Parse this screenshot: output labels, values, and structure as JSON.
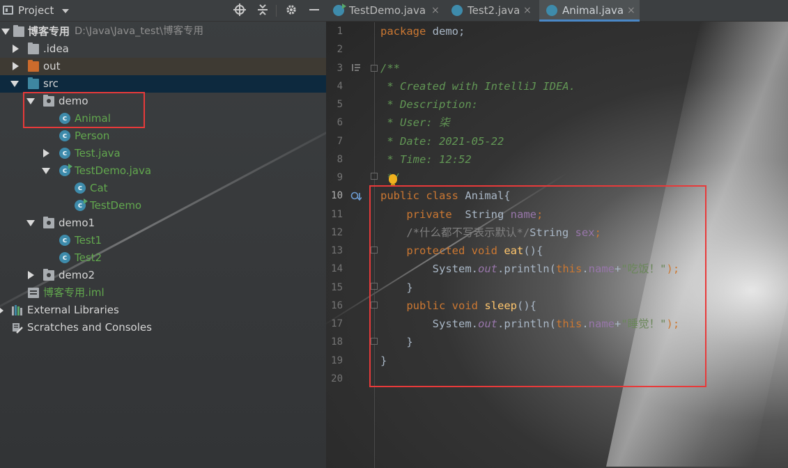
{
  "project_panel": {
    "title": "Project",
    "toolbar_icons": [
      "locate-icon",
      "collapse-icon",
      "gear-icon",
      "minimize-icon"
    ],
    "tree": [
      {
        "label": "博客专用",
        "path": "D:\\Java\\Java_test\\博客专用",
        "icon": "module-folder",
        "expanded": true
      },
      {
        "label": ".idea",
        "icon": "folder"
      },
      {
        "label": "out",
        "icon": "excluded-folder"
      },
      {
        "label": "src",
        "icon": "source-folder",
        "expanded": true
      },
      {
        "label": "demo",
        "icon": "package",
        "expanded": true
      },
      {
        "label": "Animal",
        "icon": "class"
      },
      {
        "label": "Person",
        "icon": "class"
      },
      {
        "label": "Test.java",
        "icon": "class"
      },
      {
        "label": "TestDemo.java",
        "icon": "runnable-class",
        "expanded": true
      },
      {
        "label": "Cat",
        "icon": "class"
      },
      {
        "label": "TestDemo",
        "icon": "runnable-class"
      },
      {
        "label": "demo1",
        "icon": "package",
        "expanded": true
      },
      {
        "label": "Test1",
        "icon": "class"
      },
      {
        "label": "Test2",
        "icon": "class"
      },
      {
        "label": "demo2",
        "icon": "package"
      },
      {
        "label": "博客专用.iml",
        "icon": "iml-file"
      },
      {
        "label": "External Libraries",
        "icon": "library"
      },
      {
        "label": "Scratches and Consoles",
        "icon": "scratches"
      }
    ]
  },
  "editor": {
    "tabs": [
      {
        "label": "TestDemo.java",
        "close": "×"
      },
      {
        "label": "Test2.java",
        "close": "×"
      },
      {
        "label": "Animal.java",
        "close": "×",
        "active": true
      }
    ],
    "current_line": 10,
    "line_numbers": [
      "1",
      "2",
      "3",
      "4",
      "5",
      "6",
      "7",
      "8",
      "9",
      "10",
      "11",
      "12",
      "13",
      "14",
      "15",
      "16",
      "17",
      "18",
      "19",
      "20"
    ],
    "code": {
      "l1_kw": "package",
      "l1_rest": " demo;",
      "l3": "/**",
      "l4": " * Created with IntelliJ IDEA.",
      "l5": " * Description:",
      "l6": " * User: 柒",
      "l7": " * Date: 2021-05-22",
      "l8": " * Time: 12:52",
      "l9": " */",
      "l10_kw": "public class",
      "l10_rest": " Animal{",
      "l11_indent": "    ",
      "l11_kw": "private",
      "l11_type": "  String ",
      "l11_field": "name",
      "l11_end": ";",
      "l12_indent": "    ",
      "l12_comment": "/*什么都不写表示默认*/",
      "l12_type": "String ",
      "l12_field": "sex",
      "l12_end": ";",
      "l13_indent": "    ",
      "l13_kw": "protected void",
      "l13_sp": " ",
      "l13_fn": "eat",
      "l13_end": "(){",
      "l14_indent": "        ",
      "l14_a": "System.",
      "l14_out": "out",
      "l14_b": ".println(",
      "l14_this": "this",
      "l14_dot": ".",
      "l14_field": "name",
      "l14_plus": "+",
      "l14_str": "\"吃饭！\"",
      "l14_end": ");",
      "l15": "    }",
      "l16_indent": "    ",
      "l16_kw": "public void",
      "l16_sp": " ",
      "l16_fn": "sleep",
      "l16_end": "(){",
      "l17_indent": "        ",
      "l17_a": "System.",
      "l17_out": "out",
      "l17_b": ".println(",
      "l17_this": "this",
      "l17_dot": ".",
      "l17_field": "name",
      "l17_plus": "+",
      "l17_str": "\"睡觉！\"",
      "l17_end": ");",
      "l18": "    }",
      "l19": "}"
    }
  },
  "colors": {
    "keyword": "#cc7832",
    "doc_comment": "#629755",
    "field": "#9876aa",
    "method": "#ffc66d",
    "string": "#6a8759",
    "highlight_box": "#e83a3a",
    "selection": "#0d293e"
  }
}
